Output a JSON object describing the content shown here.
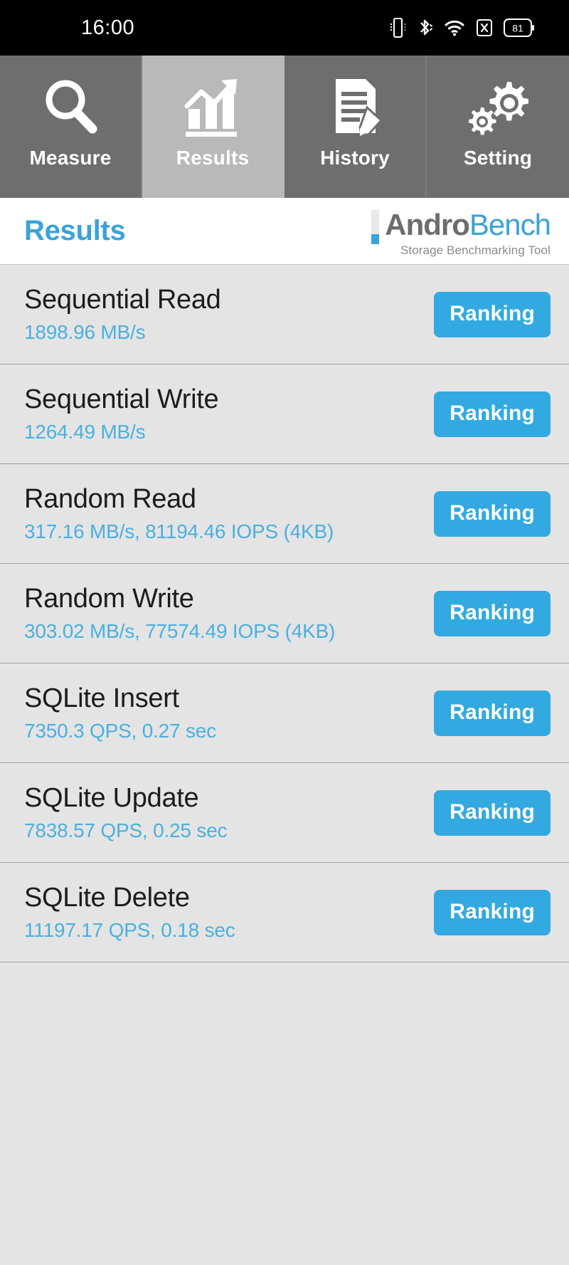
{
  "statusbar": {
    "clock": "16:00",
    "icons": [
      "vibrate-icon",
      "bluetooth-icon",
      "wifi-icon",
      "sim-disabled-icon",
      "battery-icon"
    ],
    "battery_level": "81"
  },
  "tabs": [
    {
      "label": "Measure",
      "icon": "magnifier-icon",
      "active": false
    },
    {
      "label": "Results",
      "icon": "bar-chart-icon",
      "active": true
    },
    {
      "label": "History",
      "icon": "document-edit-icon",
      "active": false
    },
    {
      "label": "Setting",
      "icon": "gears-icon",
      "active": false
    }
  ],
  "header": {
    "title": "Results",
    "brand_primary": "Andro",
    "brand_secondary": "Bench",
    "tagline": "Storage Benchmarking Tool"
  },
  "colors": {
    "accent": "#32a9e0",
    "value_text": "#4ab0e0",
    "tab_inactive": "#6e6e6e",
    "tab_active": "#b9b9b9",
    "list_bg": "#e4e4e4",
    "brand_gray": "#6d6d6d"
  },
  "results": [
    {
      "name": "Sequential Read",
      "value": "1898.96 MB/s",
      "button": "Ranking"
    },
    {
      "name": "Sequential Write",
      "value": "1264.49 MB/s",
      "button": "Ranking"
    },
    {
      "name": "Random Read",
      "value": "317.16 MB/s, 81194.46 IOPS (4KB)",
      "button": "Ranking"
    },
    {
      "name": "Random Write",
      "value": "303.02 MB/s, 77574.49 IOPS (4KB)",
      "button": "Ranking"
    },
    {
      "name": "SQLite Insert",
      "value": "7350.3 QPS, 0.27 sec",
      "button": "Ranking"
    },
    {
      "name": "SQLite Update",
      "value": "7838.57 QPS, 0.25 sec",
      "button": "Ranking"
    },
    {
      "name": "SQLite Delete",
      "value": "11197.17 QPS, 0.18 sec",
      "button": "Ranking"
    }
  ]
}
